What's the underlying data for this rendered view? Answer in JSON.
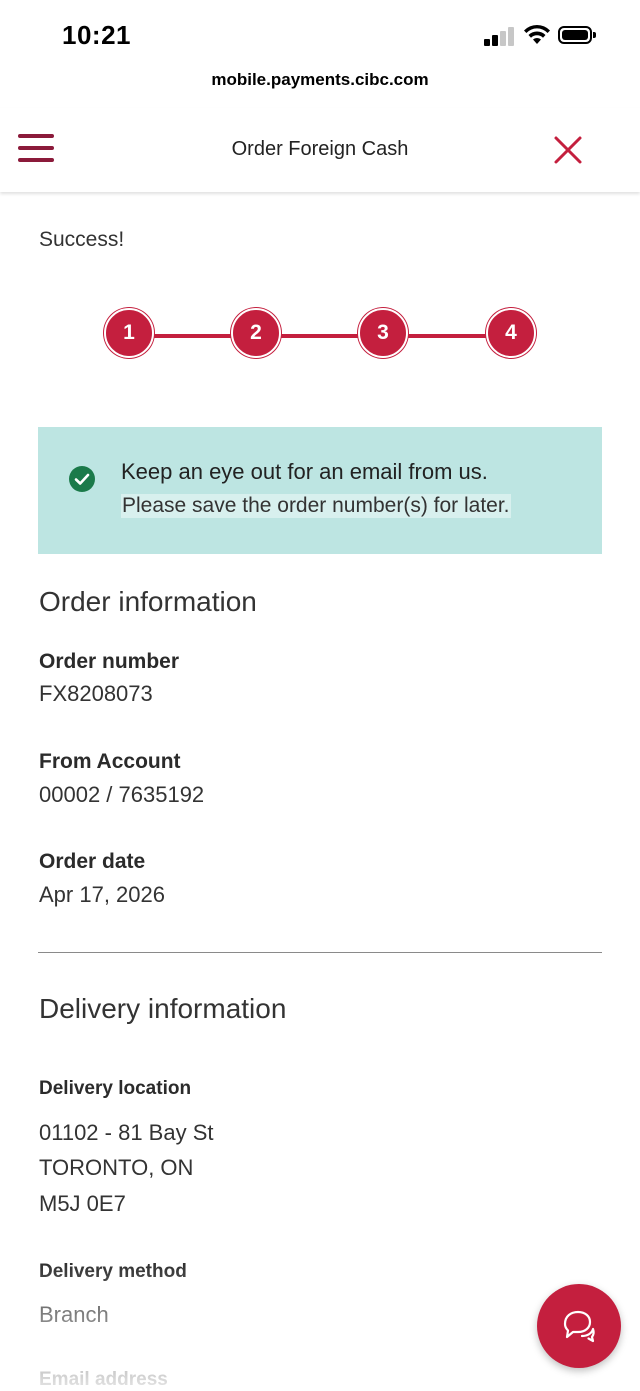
{
  "status_bar": {
    "time": "10:21"
  },
  "browser": {
    "url": "mobile.payments.cibc.com"
  },
  "header": {
    "title": "Order Foreign Cash",
    "menu_icon": "hamburger-menu-icon",
    "close_icon": "close-icon"
  },
  "page": {
    "status": "Success!"
  },
  "stepper": {
    "steps": [
      "1",
      "2",
      "3",
      "4"
    ],
    "current_step": 4,
    "total_steps": 4
  },
  "notice": {
    "title": "Keep an eye out for an email from us.",
    "subtitle": "Please save the order number(s) for later.",
    "icon": "check-circle-icon"
  },
  "order_information": {
    "heading": "Order information",
    "order_number_label": "Order number",
    "order_number": "FX8208073",
    "from_account_label": "From Account",
    "from_account": "00002 / 7635192",
    "order_date_label": "Order date",
    "order_date": "Apr 17, 2026"
  },
  "delivery_information": {
    "heading": "Delivery information",
    "location_label": "Delivery location",
    "location_line1": "01102 - 81 Bay St",
    "location_line2": "TORONTO, ON",
    "location_line3": "M5J 0E7",
    "method_label": "Delivery method",
    "method": "Branch",
    "email_label": "Email address"
  },
  "chat": {
    "icon": "chat-bubbles-icon"
  },
  "colors": {
    "brand": "#c41f3e",
    "menu": "#8b1a3a",
    "notice_bg": "#bde5e2",
    "check": "#1b7a4a"
  }
}
